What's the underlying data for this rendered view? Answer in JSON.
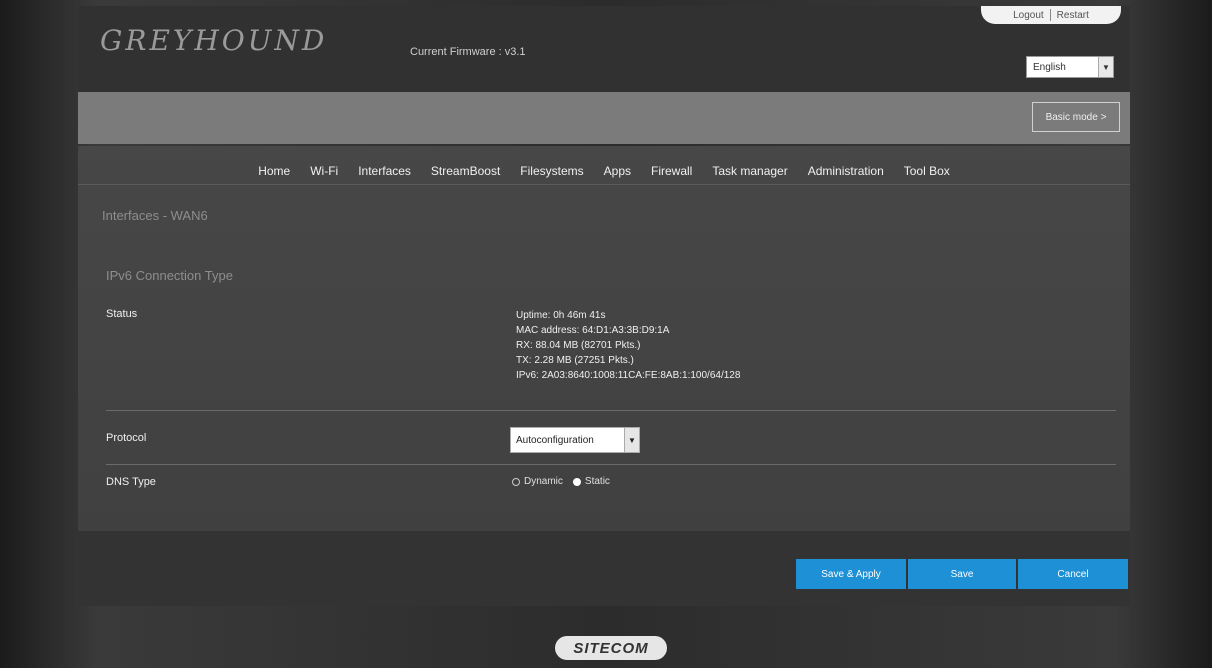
{
  "header": {
    "logo": "GREYHOUND",
    "firmware": "Current Firmware : v3.1",
    "logout": "Logout",
    "restart": "Restart",
    "language": "English"
  },
  "mode_button": "Basic mode >",
  "nav": {
    "items": [
      "Home",
      "Wi-Fi",
      "Interfaces",
      "StreamBoost",
      "Filesystems",
      "Apps",
      "Firewall",
      "Task manager",
      "Administration",
      "Tool Box"
    ]
  },
  "breadcrumb": "Interfaces - WAN6",
  "section_title": "IPv6 Connection Type",
  "status": {
    "label": "Status",
    "lines": [
      "Uptime: 0h 46m 41s",
      "MAC address: 64:D1:A3:3B:D9:1A",
      "RX: 88.04 MB (82701 Pkts.)",
      "TX: 2.28 MB (27251 Pkts.)",
      "IPv6: 2A03:8640:1008:11CA:FE:8AB:1:100/64/128"
    ]
  },
  "protocol": {
    "label": "Protocol",
    "value": "Autoconfiguration"
  },
  "dns": {
    "label": "DNS Type",
    "options": [
      "Dynamic",
      "Static"
    ],
    "selected": "Static"
  },
  "buttons": {
    "save_apply": "Save & Apply",
    "save": "Save",
    "cancel": "Cancel"
  },
  "footer_brand": "SITECOM",
  "colors": {
    "accent": "#1e90d6",
    "page_bg": "#2a2a2a",
    "content_bg": "#444444"
  }
}
